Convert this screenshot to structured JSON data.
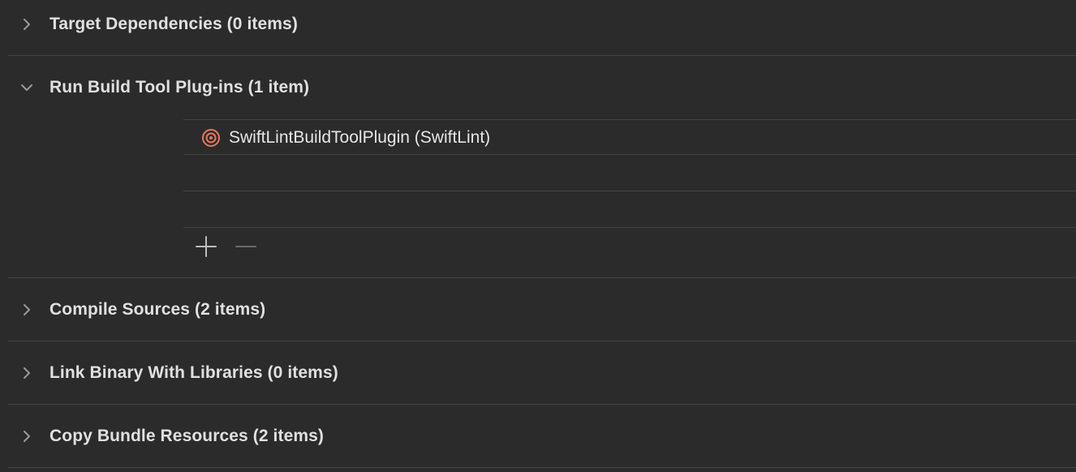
{
  "sections": [
    {
      "title": "Target Dependencies (0 items)",
      "expanded": false
    },
    {
      "title": "Run Build Tool Plug-ins (1 item)",
      "expanded": true
    },
    {
      "title": "Compile Sources (2 items)",
      "expanded": false
    },
    {
      "title": "Link Binary With Libraries (0 items)",
      "expanded": false
    },
    {
      "title": "Copy Bundle Resources (2 items)",
      "expanded": false
    }
  ],
  "plugins": [
    {
      "name": "SwiftLintBuildToolPlugin (SwiftLint)",
      "icon": "target-plugin-icon"
    }
  ],
  "colors": {
    "background": "#2b2b2b",
    "divider": "#474747",
    "plugin_icon": "#e8765c",
    "title_text": "#e0e0e0"
  }
}
